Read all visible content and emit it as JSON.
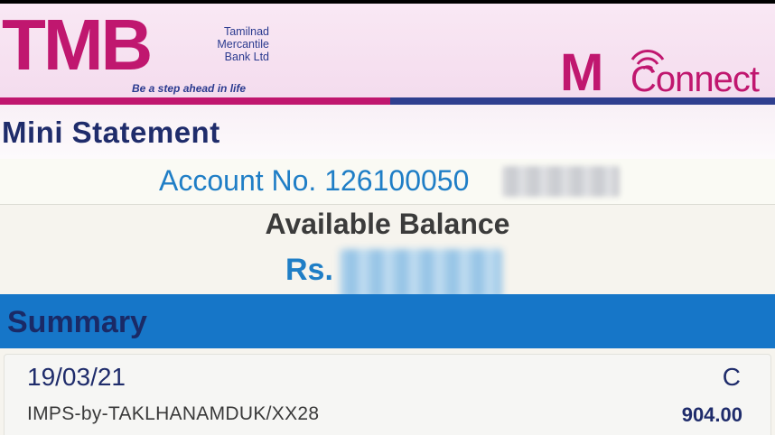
{
  "header": {
    "logo_text": "TMB",
    "bank_name_line1": "Tamilnad",
    "bank_name_line2": "Mercantile",
    "bank_name_line3": "Bank Ltd",
    "tagline": "Be a step ahead in life",
    "app_logo_mark": "M",
    "app_logo_text": "Connect"
  },
  "colors": {
    "brand_pink": "#c0176f",
    "brand_navy": "#2f3f8f",
    "summary_blue": "#1676c8",
    "account_blue": "#1f7ec6"
  },
  "page": {
    "title": "Mini Statement"
  },
  "account": {
    "label": "Account No. 126100050"
  },
  "balance": {
    "label": "Available Balance",
    "prefix": "Rs."
  },
  "summary": {
    "title": "Summary",
    "transactions": [
      {
        "date": "19/03/21",
        "type": "C",
        "description": "IMPS-by-TAKLHANAMDUK/XX28",
        "amount": "904.00"
      }
    ]
  }
}
